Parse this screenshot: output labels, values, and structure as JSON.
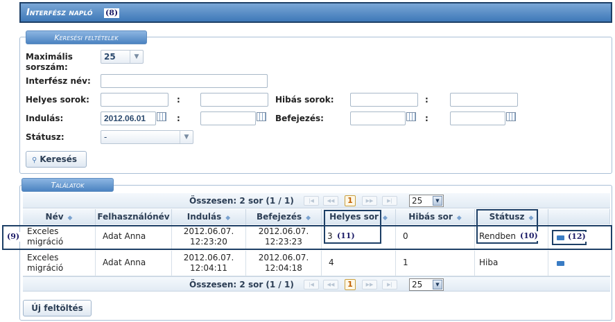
{
  "title": {
    "text": "Interfész napló",
    "anno": "(8)"
  },
  "search": {
    "legend": "Keresési feltételek",
    "max_label": "Maximális sorszám:",
    "max_value": "25",
    "iface_label": "Interfész név:",
    "iface_value": "",
    "ok_rows_label": "Helyes sorok:",
    "err_rows_label": "Hibás sorok:",
    "start_label": "Indulás:",
    "start_value": "2012.06.01",
    "end_label": "Befejezés:",
    "status_label": "Státusz:",
    "status_value": "-",
    "colon": ":",
    "search_button": "Keresés"
  },
  "results": {
    "legend": "Találatok",
    "pager": {
      "summary": "Összesen: 2 sor (1 / 1)",
      "current_page": "1",
      "page_size": "25"
    },
    "columns": [
      "Név",
      "Felhasználónév",
      "Indulás",
      "Befejezés",
      "Helyes sor",
      "Hibás sor",
      "Státusz",
      ""
    ],
    "rows": [
      {
        "name": "Exceles migráció",
        "user": "Adat Anna",
        "start": "2012.06.07. 12:23:20",
        "end": "2012.06.07. 12:23:23",
        "ok": "3",
        "err": "0",
        "status": "Rendben"
      },
      {
        "name": "Exceles migráció",
        "user": "Adat Anna",
        "start": "2012.06.07. 12:04:11",
        "end": "2012.06.07. 12:04:18",
        "ok": "4",
        "err": "1",
        "status": "Hiba"
      }
    ],
    "annotations": {
      "row": "(9)",
      "ok": "(11)",
      "status": "(10)",
      "action": "(12)"
    }
  },
  "upload_button": "Új feltöltés",
  "icons": {
    "calendar": "calendar-icon",
    "search": "search-icon",
    "folder": "folder-open-icon"
  }
}
